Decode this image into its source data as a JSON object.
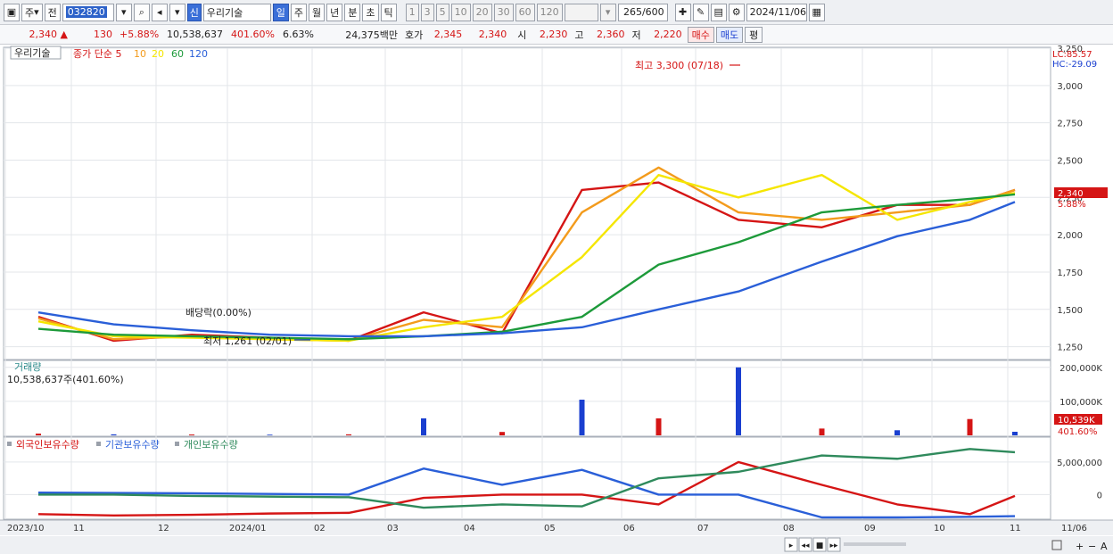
{
  "toolbar": {
    "type_label": "주",
    "prev_label": "전",
    "code": "032820",
    "badge": "신",
    "name": "우리기술",
    "periods": [
      "일",
      "주",
      "월",
      "년",
      "분",
      "초",
      "틱"
    ],
    "active_period": "일",
    "intervals": [
      "1",
      "3",
      "5",
      "10",
      "20",
      "30",
      "60",
      "120"
    ],
    "count": "265",
    "count_total": "/600",
    "date": "2024/11/06"
  },
  "quote": {
    "price": "2,340",
    "change": "130",
    "change_pct": "+5.88%",
    "volume": "10,538,637",
    "volume_ratio": "401.60%",
    "turnover": "6.63%",
    "amount": "24,375백만",
    "bid_label": "호가",
    "ask": "2,345",
    "bid": "2,340",
    "open_label": "시",
    "open": "2,230",
    "high_label": "고",
    "high": "2,360",
    "low_label": "저",
    "low": "2,220",
    "buy_label": "매수",
    "sell_label": "매도",
    "eval_label": "평"
  },
  "colors": {
    "up": "#d51515",
    "down": "#1a3fd0",
    "ma5": "#d51515",
    "ma10": "#f39b1c",
    "ma20": "#f5e600",
    "ma60": "#1d9a3a",
    "ma120": "#2a5fd8",
    "foreign": "#d51515",
    "institution": "#2a5fd8",
    "individual": "#2f8a5c"
  },
  "chart_data": [
    {
      "type": "line",
      "title": "우리기술",
      "legend": {
        "label": "종가 단순",
        "periods": [
          "5",
          "10",
          "20",
          "60",
          "120"
        ]
      },
      "right_labels": {
        "lc": "LC:85.57",
        "hc": "HC:-29.09"
      },
      "x_ticks": [
        "2023/10",
        "11",
        "12",
        "2024/01",
        "02",
        "03",
        "04",
        "05",
        "06",
        "07",
        "08",
        "09",
        "10",
        "11",
        "11/06"
      ],
      "y_ticks": [
        "1,250",
        "1,500",
        "1,750",
        "2,000",
        "2,250",
        "2,500",
        "2,750",
        "3,000",
        "3,250"
      ],
      "ylim": [
        1170,
        3250
      ],
      "x": [
        "2023/10",
        "2023/11",
        "2023/12",
        "2024/01",
        "2024/02",
        "2024/03",
        "2024/04",
        "2024/05",
        "2024/06",
        "2024/07",
        "2024/08",
        "2024/09",
        "2024/10",
        "2024/11"
      ],
      "series": [
        {
          "name": "5",
          "values": [
            1450,
            1290,
            1330,
            1310,
            1290,
            1480,
            1340,
            2300,
            2350,
            2100,
            2050,
            2200,
            2200,
            2300
          ]
        },
        {
          "name": "10",
          "values": [
            1440,
            1300,
            1320,
            1300,
            1290,
            1430,
            1380,
            2150,
            2450,
            2150,
            2100,
            2150,
            2200,
            2300
          ]
        },
        {
          "name": "20",
          "values": [
            1420,
            1320,
            1310,
            1300,
            1290,
            1380,
            1450,
            1850,
            2400,
            2250,
            2400,
            2100,
            2220,
            2280
          ]
        },
        {
          "name": "60",
          "values": [
            1370,
            1330,
            1320,
            1310,
            1300,
            1320,
            1350,
            1450,
            1800,
            1950,
            2150,
            2200,
            2240,
            2270
          ]
        },
        {
          "name": "120",
          "values": [
            1480,
            1400,
            1360,
            1330,
            1320,
            1320,
            1340,
            1380,
            1500,
            1620,
            1820,
            1990,
            2100,
            2220
          ]
        }
      ],
      "high_annotation": "최고 3,300 (07/18)",
      "low_annotation": "최저 1,261 (02/01)",
      "dividend_annotation": "배당락(0.00%)",
      "last_price_label": "2,340",
      "last_change_label": "5.88%"
    },
    {
      "type": "bar",
      "title": "거래량",
      "value_label": "10,538,637주(401.60%)",
      "y_ticks": [
        "100,000K",
        "200,000K"
      ],
      "ylim": [
        0,
        210000
      ],
      "last_label": "10,539K",
      "last_ratio_label": "401.60%",
      "categories": [
        "2023/10",
        "2023/11",
        "2023/12",
        "2024/01",
        "2024/02",
        "2024/03",
        "2024/04",
        "2024/05",
        "2024/06",
        "2024/07",
        "2024/08",
        "2024/09",
        "2024/10",
        "2024/11"
      ],
      "values": [
        5000,
        3000,
        2500,
        2000,
        3000,
        50000,
        10000,
        105000,
        50000,
        200000,
        20000,
        15000,
        48000,
        10539
      ]
    },
    {
      "type": "line",
      "legend": [
        "외국인보유수량",
        "기관보유수량",
        "개인보유수량"
      ],
      "y_ticks": [
        "0",
        "5,000,000"
      ],
      "ylim": [
        -3500000,
        8000000
      ],
      "x": [
        "2023/10",
        "2023/11",
        "2023/12",
        "2024/01",
        "2024/02",
        "2024/03",
        "2024/04",
        "2024/05",
        "2024/06",
        "2024/07",
        "2024/08",
        "2024/09",
        "2024/10",
        "2024/11"
      ],
      "series": [
        {
          "name": "외국인보유수량",
          "values": [
            -3000000,
            -3200000,
            -3100000,
            -2900000,
            -2800000,
            -500000,
            0,
            0,
            -1500000,
            5000000,
            1500000,
            -1500000,
            -3000000,
            -200000
          ]
        },
        {
          "name": "기관보유수량",
          "values": [
            300000,
            250000,
            200000,
            100000,
            0,
            4000000,
            1500000,
            3800000,
            0,
            0,
            -3500000,
            -3500000,
            -3400000,
            -3300000
          ]
        },
        {
          "name": "개인보유수량",
          "values": [
            0,
            0,
            -200000,
            -300000,
            -400000,
            -2000000,
            -1500000,
            -1800000,
            2500000,
            3500000,
            6000000,
            5500000,
            7000000,
            6500000
          ]
        }
      ]
    }
  ]
}
